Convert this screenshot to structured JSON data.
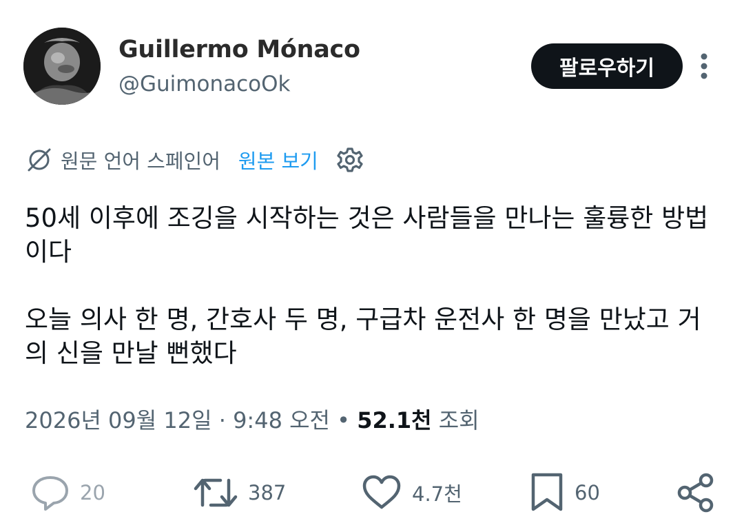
{
  "header": {
    "display_name": "Guillermo Mónaco",
    "handle": "@GuimonacoOk",
    "follow_label": "팔로우하기"
  },
  "translation": {
    "label": "원문 언어 스페인어",
    "show_original": "원본 보기"
  },
  "tweet": {
    "paragraph_1": "50세 이후에 조깅을 시작하는 것은 사람들을 만나는 훌륭한 방법이다",
    "paragraph_2": "오늘 의사 한 명, 간호사 두 명, 구급차 운전사 한 명을 만났고 거의 신을 만날 뻔했다"
  },
  "meta": {
    "date": "2026년 09월 12일",
    "sep1": " · ",
    "time": "9:48 오전",
    "sep2": " • ",
    "views_count": "52.1천",
    "views_label": " 조회"
  },
  "actions": {
    "reply_count": "20",
    "repost_count": "387",
    "like_count": "4.7천",
    "bookmark_count": "60"
  },
  "icons": {
    "avatar": "avatar-photo",
    "more": "more-vertical-icon",
    "translate": "translate-globe-icon",
    "settings": "gear-icon",
    "reply": "reply-icon",
    "repost": "repost-icon",
    "like": "heart-icon",
    "bookmark": "bookmark-icon",
    "share": "share-icon"
  },
  "colors": {
    "text_primary": "#0f1419",
    "text_secondary": "#536471",
    "link": "#1d9bf0",
    "follow_bg": "#0f1419",
    "follow_text": "#ffffff"
  }
}
